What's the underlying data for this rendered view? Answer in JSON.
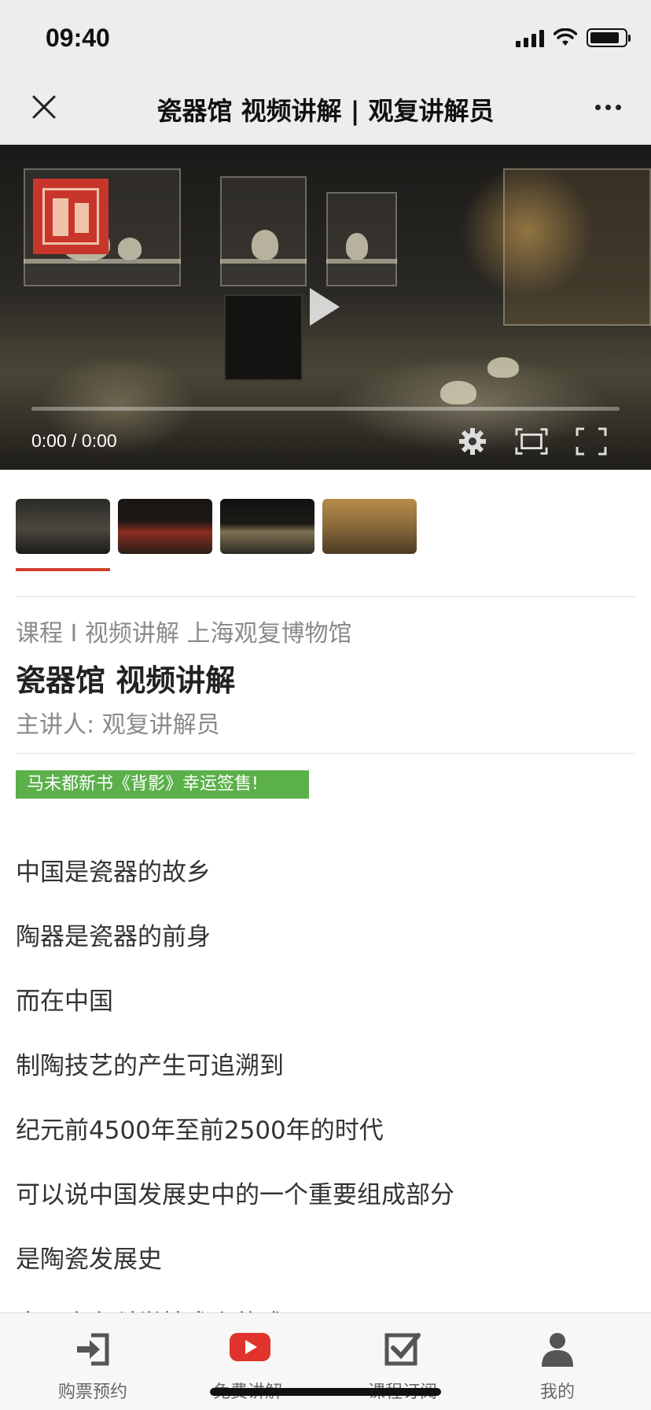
{
  "status_bar": {
    "time": "09:40"
  },
  "nav": {
    "title": "瓷器馆 视频讲解 | 观复讲解员",
    "close_icon": "close-icon",
    "more_icon": "more-dots-icon"
  },
  "video": {
    "time_display": "0:00 / 0:00",
    "progress": 0
  },
  "thumbnails": [
    {
      "label": "thumbnail-1",
      "selected": true
    },
    {
      "label": "thumbnail-2",
      "selected": false
    },
    {
      "label": "thumbnail-3",
      "selected": false
    },
    {
      "label": "thumbnail-4",
      "selected": false
    }
  ],
  "course": {
    "meta": "课程 I 视频讲解 上海观复博物馆",
    "title": "瓷器馆 视频讲解",
    "speaker": "主讲人: 观复讲解员",
    "banner": "马未都新书《背影》幸运签售!"
  },
  "paragraphs": [
    "中国是瓷器的故乡",
    "陶器是瓷器的前身",
    "而在中国",
    "制陶技艺的产生可追溯到",
    "纪元前4500年至前2500年的时代",
    "可以说中国发展史中的一个重要组成部分",
    "是陶瓷发展史",
    "中国人在科学技术上的成果"
  ],
  "tabs": [
    {
      "label": "购票预约",
      "icon": "ticket-login-icon"
    },
    {
      "label": "免费讲解",
      "icon": "video-play-icon"
    },
    {
      "label": "课程订阅",
      "icon": "checkbox-icon"
    },
    {
      "label": "我的",
      "icon": "user-icon"
    }
  ],
  "colors": {
    "accent": "#d2402f",
    "banner": "#5bb04a",
    "play_red": "#e0332c"
  }
}
